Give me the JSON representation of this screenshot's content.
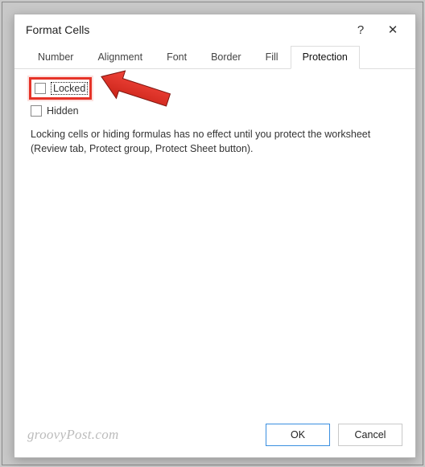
{
  "dialog": {
    "title": "Format Cells",
    "help_label": "?",
    "close_label": "✕"
  },
  "tabs": {
    "items": [
      {
        "label": "Number"
      },
      {
        "label": "Alignment"
      },
      {
        "label": "Font"
      },
      {
        "label": "Border"
      },
      {
        "label": "Fill"
      },
      {
        "label": "Protection"
      }
    ],
    "active_index": 5
  },
  "protection": {
    "locked_label": "Locked",
    "hidden_label": "Hidden",
    "info_text": "Locking cells or hiding formulas has no effect until you protect the worksheet (Review tab, Protect group, Protect Sheet button)."
  },
  "footer": {
    "watermark": "groovyPost.com",
    "ok_label": "OK",
    "cancel_label": "Cancel"
  }
}
